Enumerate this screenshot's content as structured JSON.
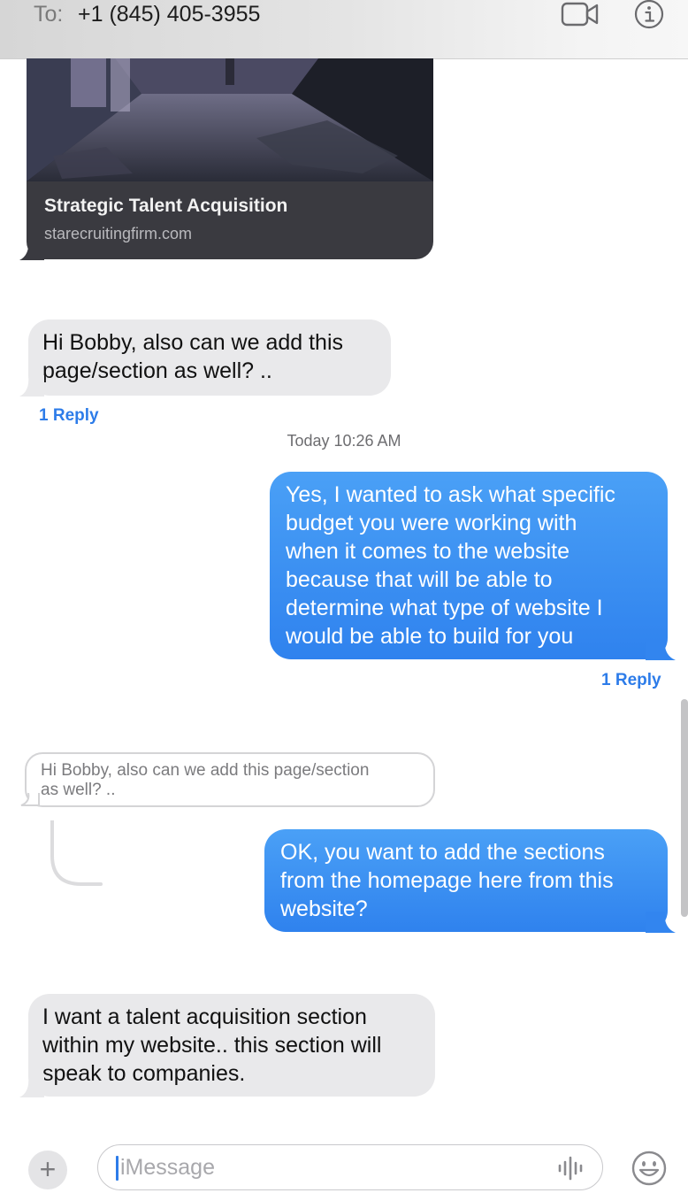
{
  "header": {
    "to_label": "To:",
    "recipient": "+1 (845) 405-3955",
    "video_icon": "video-camera-icon",
    "info_icon": "info-icon"
  },
  "link_preview": {
    "title": "Strategic Talent Acquisition",
    "domain": "starecruitingfirm.com"
  },
  "messages": [
    {
      "direction": "incoming",
      "lines": [
        "Hi Bobby, also can we add this",
        "page/section as well? .."
      ],
      "reply_label": "1 Reply"
    },
    {
      "timestamp": "Today 10:26 AM"
    },
    {
      "direction": "outgoing",
      "lines": [
        "Yes, I wanted to ask what specific",
        "budget you were working with",
        "when it comes to the website",
        "because that will be able to",
        "determine what type of website I",
        "would be able to build for you"
      ],
      "reply_label": "1 Reply"
    },
    {
      "direction": "quoted",
      "lines": [
        "Hi Bobby, also can we add this page/section",
        "as well? .."
      ]
    },
    {
      "direction": "outgoing",
      "lines": [
        "OK, you want to add the sections",
        "from the homepage here from this",
        "website?"
      ]
    },
    {
      "direction": "incoming",
      "lines": [
        "I want a talent acquisition section",
        "within my website.. this section will",
        "speak to companies."
      ]
    }
  ],
  "composer": {
    "plus_label": "+",
    "placeholder": "iMessage",
    "audio_icon": "waveform-icon",
    "emoji_icon": "emoji-icon"
  },
  "colors": {
    "outgoing_bubble": "#3b8ff2",
    "incoming_bubble": "#e9e9eb",
    "reply_link": "#2d7ce9",
    "link_preview_bg": "#3a3a40"
  }
}
